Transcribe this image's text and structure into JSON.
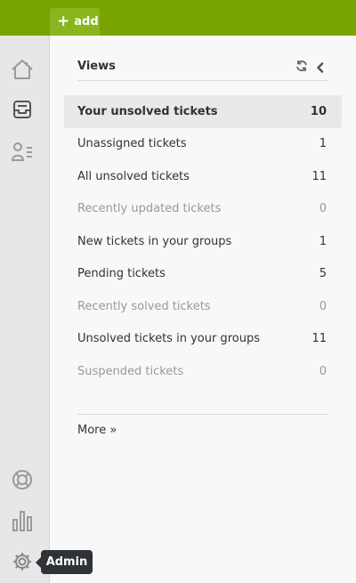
{
  "toolbar": {
    "add_label": "add",
    "add_icon": "plus-icon",
    "accent": "#78a300"
  },
  "nav": [
    {
      "name": "home",
      "icon": "home-icon"
    },
    {
      "name": "views",
      "icon": "inbox-icon",
      "active": true
    },
    {
      "name": "customers",
      "icon": "user-list-icon"
    },
    {
      "name": "help",
      "icon": "lifebuoy-icon"
    },
    {
      "name": "reporting",
      "icon": "bar-chart-icon"
    },
    {
      "name": "admin",
      "icon": "gear-icon"
    }
  ],
  "views": {
    "title": "Views",
    "refresh_icon": "refresh-icon",
    "collapse_icon": "chevron-left-icon",
    "items": [
      {
        "label": "Your unsolved tickets",
        "count": "10",
        "active": true
      },
      {
        "label": "Unassigned tickets",
        "count": "1"
      },
      {
        "label": "All unsolved tickets",
        "count": "11"
      },
      {
        "label": "Recently updated tickets",
        "count": "0",
        "muted": true
      },
      {
        "label": "New tickets in your groups",
        "count": "1"
      },
      {
        "label": "Pending tickets",
        "count": "5"
      },
      {
        "label": "Recently solved tickets",
        "count": "0",
        "muted": true
      },
      {
        "label": "Unsolved tickets in your groups",
        "count": "11"
      },
      {
        "label": "Suspended tickets",
        "count": "0",
        "muted": true
      }
    ],
    "more_label": "More »"
  },
  "tooltip": {
    "text": "Admin"
  }
}
